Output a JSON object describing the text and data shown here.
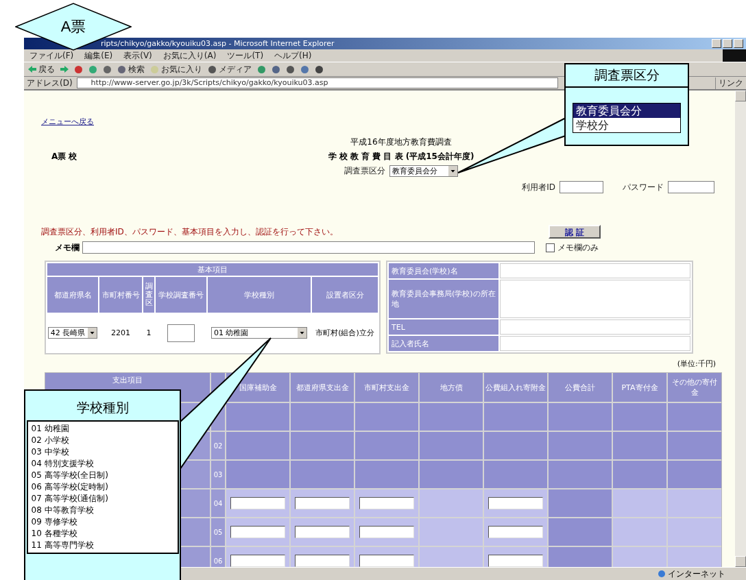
{
  "callouts": {
    "form_tag": "A票",
    "division": {
      "title": "調査票区分",
      "options": [
        {
          "label": "教育委員会分",
          "selected": true
        },
        {
          "label": "学校分",
          "selected": false
        }
      ]
    },
    "school_type": {
      "title": "学校種別",
      "items": [
        "01 幼稚園",
        "02 小学校",
        "03 中学校",
        "04 特別支援学校",
        "05 高等学校(全日制)",
        "06 高等学校(定時制)",
        "07 高等学校(通信制)",
        "08 中等教育学校",
        "09 専修学校",
        "10 各種学校",
        "11 高等専門学校"
      ]
    }
  },
  "browser": {
    "title": "ripts/chikyo/gakko/kyouiku03.asp - Microsoft Internet Explorer",
    "menu": [
      "ファイル(F)",
      "編集(E)",
      "表示(V)",
      "お気に入り(A)",
      "ツール(T)",
      "ヘルプ(H)"
    ],
    "toolbar": [
      {
        "kind": "back",
        "label": "戻る"
      },
      {
        "kind": "forward"
      },
      {
        "kind": "stop"
      },
      {
        "kind": "refresh"
      },
      {
        "kind": "home"
      },
      {
        "kind": "search",
        "label": "検索"
      },
      {
        "kind": "favorites",
        "label": "お気に入り"
      },
      {
        "kind": "media",
        "label": "メディア"
      },
      {
        "kind": "history"
      },
      {
        "kind": "mail"
      },
      {
        "kind": "print"
      },
      {
        "kind": "edit"
      },
      {
        "kind": "messenger"
      }
    ],
    "address_label": "アドレス(D)",
    "url": "http://www-server.go.jp/3k/Scripts/chikyo/gakko/kyouiku03.asp",
    "links_label": "リンク",
    "status": "インターネット"
  },
  "page": {
    "back_link": "メニューへ戻る",
    "form_code": "A票 校",
    "survey_title": "平成16年度地方教育費調査",
    "table_title": "学 校 教 育 費 目 表 (平成15会計年度)",
    "division_label": "調査票区分",
    "division_value": "教育委員会分",
    "user_id_label": "利用者ID",
    "password_label": "パスワード",
    "instruction": "調査票区分、利用者ID、パスワード、基本項目を入力し、認証を行って下さい。",
    "auth_button": "認 証",
    "memo_label": "メモ欄",
    "memo_check": {
      "label": "メモ欄のみ",
      "checked": false
    },
    "basic": {
      "title": "基本項目",
      "columns": [
        "都道府県名",
        "市町村番号",
        "調査区",
        "学校調査番号",
        "学校種別",
        "設置者区分"
      ],
      "values": [
        {
          "kind": "select",
          "text": "42 長崎県"
        },
        {
          "kind": "text",
          "text": "2201"
        },
        {
          "kind": "text",
          "text": "1"
        },
        {
          "kind": "input"
        },
        {
          "kind": "select",
          "text": "01 幼稚園"
        },
        {
          "kind": "text",
          "text": "市町村(組合)立分"
        }
      ]
    },
    "contact": [
      {
        "label": "教育委員会(学校)名",
        "tall": false
      },
      {
        "label": "教育委員会事務局(学校)の所在地",
        "tall": true
      },
      {
        "label": "TEL",
        "tall": false
      },
      {
        "label": "記入者氏名",
        "tall": false
      }
    ],
    "unit": "(単位:千円)",
    "expenses": {
      "columns": [
        "支出項目",
        "国庫補助金",
        "都道府県支出金",
        "市町村支出金",
        "地方債",
        "公費組入れ寄附金",
        "公費合計",
        "PTA寄付金",
        "その他の寄付金"
      ],
      "rows": [
        {
          "cells": [
            {
              "kind": "filled"
            },
            {
              "kind": "filled"
            },
            {
              "kind": "filled"
            },
            {
              "kind": "filled"
            },
            {
              "kind": "filled"
            },
            {
              "kind": "filled"
            },
            {
              "kind": "filled"
            },
            {
              "kind": "filled"
            }
          ]
        },
        {
          "number": "02",
          "cells": [
            {
              "kind": "filled"
            },
            {
              "kind": "filled"
            },
            {
              "kind": "filled"
            },
            {
              "kind": "filled"
            },
            {
              "kind": "filled"
            },
            {
              "kind": "filled"
            },
            {
              "kind": "filled"
            },
            {
              "kind": "filled"
            }
          ]
        },
        {
          "number": "03",
          "cells": [
            {
              "kind": "filled"
            },
            {
              "kind": "filled"
            },
            {
              "kind": "filled"
            },
            {
              "kind": "filled"
            },
            {
              "kind": "filled"
            },
            {
              "kind": "filled"
            },
            {
              "kind": "filled"
            },
            {
              "kind": "filled"
            }
          ]
        },
        {
          "number": "04",
          "cells": [
            {
              "kind": "input"
            },
            {
              "kind": "input"
            },
            {
              "kind": "input"
            },
            {
              "kind": "light"
            },
            {
              "kind": "input"
            },
            {
              "kind": "filled"
            },
            {
              "kind": "light"
            },
            {
              "kind": "light"
            }
          ]
        },
        {
          "number": "05",
          "cells": [
            {
              "kind": "input"
            },
            {
              "kind": "input"
            },
            {
              "kind": "input"
            },
            {
              "kind": "light"
            },
            {
              "kind": "input"
            },
            {
              "kind": "filled"
            },
            {
              "kind": "light"
            },
            {
              "kind": "light"
            }
          ]
        },
        {
          "number": "06",
          "cells": [
            {
              "kind": "input"
            },
            {
              "kind": "input"
            },
            {
              "kind": "input"
            },
            {
              "kind": "light"
            },
            {
              "kind": "input"
            },
            {
              "kind": "filled"
            },
            {
              "kind": "light"
            },
            {
              "kind": "light"
            }
          ]
        }
      ]
    }
  }
}
